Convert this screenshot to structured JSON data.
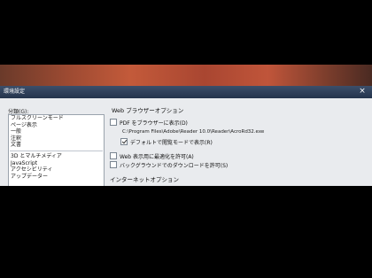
{
  "dialog": {
    "title": "環境設定",
    "close_glyph": "×"
  },
  "categories": {
    "label": "分類(G):",
    "group1": [
      "フルスクリーンモード",
      "ページ表示",
      "一般",
      "注釈",
      "文書"
    ],
    "group2": [
      "3D とマルチメディア",
      "JavaScript",
      "アクセシビリティ",
      "アップデーター"
    ]
  },
  "web_options": {
    "section_title": "Web ブラウザーオプション",
    "pdf_in_browser": {
      "label": "PDF をブラウザーに表示(D)",
      "checked": false
    },
    "reader_path": "C:\\Program Files\\Adobe\\Reader 10.0\\Reader\\AcroRd32.exe",
    "default_reading_mode": {
      "label": "デフォルトで閲覧モードで表示(R)",
      "checked": true
    },
    "fast_web_view": {
      "label": "Web 表示用に最適化を許可(A)",
      "checked": false
    },
    "background_download": {
      "label": "バックグラウンドでのダウンロードを許可(S)",
      "checked": false
    }
  },
  "next_section_title": "インターネットオプション"
}
